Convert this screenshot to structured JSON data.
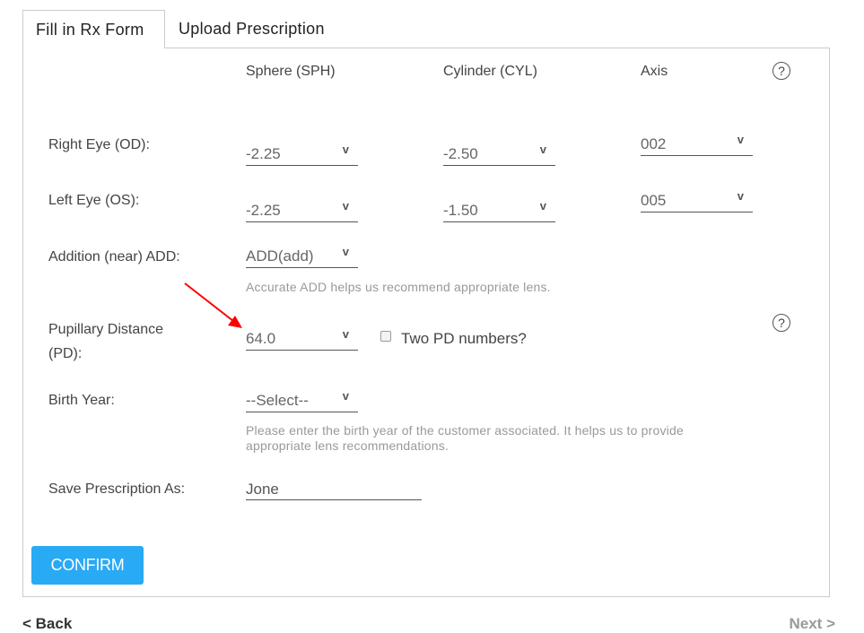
{
  "tabs": [
    {
      "label": "Fill in Rx Form",
      "active": true
    },
    {
      "label": "Upload Prescription",
      "active": false
    }
  ],
  "columns": {
    "sphere": "Sphere (SPH)",
    "cylinder": "Cylinder (CYL)",
    "axis": "Axis"
  },
  "rows": {
    "right_eye": {
      "label": "Right Eye (OD):",
      "sph": "-2.25",
      "cyl": "-2.50",
      "axis": "002"
    },
    "left_eye": {
      "label": "Left Eye (OS):",
      "sph": "-2.25",
      "cyl": "-1.50",
      "axis": "005"
    },
    "add": {
      "label": "Addition (near) ADD:",
      "value": "ADD(add)",
      "hint": "Accurate ADD helps us recommend appropriate lens."
    },
    "pd": {
      "label_line1": "Pupillary Distance",
      "label_line2": "(PD):",
      "value": "64.0",
      "two_pd_label": "Two PD numbers?",
      "two_pd_checked": false
    },
    "birth_year": {
      "label": "Birth Year:",
      "value": "--Select--",
      "hint_line1": "Please enter the birth year of the customer associated. It helps us to provide",
      "hint_line2": "appropriate lens recommendations."
    },
    "save_as": {
      "label": "Save Prescription As:",
      "value": "Jone"
    }
  },
  "icons": {
    "chevron": "v",
    "help": "?"
  },
  "buttons": {
    "confirm": "CONFIRM",
    "back": "< Back",
    "next": "Next >"
  },
  "colors": {
    "confirm_bg": "#29aaf5",
    "annotation_arrow": "#ff0000"
  }
}
